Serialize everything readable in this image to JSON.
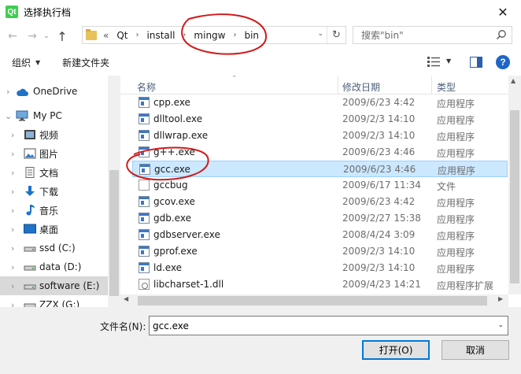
{
  "window": {
    "app_icon_letter": "Qt",
    "title": "选择执行档",
    "close_glyph": "✕"
  },
  "navigation": {
    "back_glyph": "←",
    "forward_glyph": "→",
    "recent_glyph": "⌄",
    "up_glyph": "↑"
  },
  "address": {
    "overflow": "«",
    "crumbs": [
      "Qt",
      "install",
      "mingw",
      "bin"
    ],
    "separator": "›",
    "dropdown_glyph": "⌄",
    "refresh_glyph": "↻"
  },
  "search": {
    "placeholder": "搜索\"bin\""
  },
  "toolbar": {
    "organize_label": "组织",
    "organize_caret": "▼",
    "new_folder_label": "新建文件夹",
    "view_caret": "▼",
    "help_glyph": "?"
  },
  "nav_pane": {
    "items": [
      {
        "label": "OneDrive",
        "icon": "cloud-icon",
        "chevron": "›"
      },
      {
        "label": "My PC",
        "icon": "computer-icon",
        "chevron": "⌄"
      },
      {
        "label": "视频",
        "icon": "video-folder-icon",
        "chevron": "›"
      },
      {
        "label": "图片",
        "icon": "pictures-folder-icon",
        "chevron": "›"
      },
      {
        "label": "文档",
        "icon": "documents-folder-icon",
        "chevron": "›"
      },
      {
        "label": "下载",
        "icon": "download-arrow-icon",
        "chevron": "›"
      },
      {
        "label": "音乐",
        "icon": "music-note-icon",
        "chevron": "›"
      },
      {
        "label": "桌面",
        "icon": "desktop-icon",
        "chevron": "›"
      },
      {
        "label": "ssd (C:)",
        "icon": "drive-icon",
        "chevron": "›"
      },
      {
        "label": "data (D:)",
        "icon": "drive-icon",
        "chevron": "›"
      },
      {
        "label": "software (E:)",
        "icon": "drive-icon",
        "chevron": "›",
        "selected": true
      },
      {
        "label": "ZZX (G:)",
        "icon": "drive-icon",
        "chevron": "›"
      }
    ]
  },
  "file_list": {
    "sort_glyph": "⌃",
    "columns": [
      "名称",
      "修改日期",
      "类型"
    ],
    "rows": [
      {
        "name": "cpp.exe",
        "date": "2009/6/23 4:42",
        "type": "应用程序",
        "icon": "exe"
      },
      {
        "name": "dlltool.exe",
        "date": "2009/2/3 14:10",
        "type": "应用程序",
        "icon": "exe"
      },
      {
        "name": "dllwrap.exe",
        "date": "2009/2/3 14:10",
        "type": "应用程序",
        "icon": "exe"
      },
      {
        "name": "g++.exe",
        "date": "2009/6/23 4:46",
        "type": "应用程序",
        "icon": "exe"
      },
      {
        "name": "gcc.exe",
        "date": "2009/6/23 4:46",
        "type": "应用程序",
        "icon": "exe",
        "selected": true
      },
      {
        "name": "gccbug",
        "date": "2009/6/17 11:34",
        "type": "文件",
        "icon": "file"
      },
      {
        "name": "gcov.exe",
        "date": "2009/6/23 4:42",
        "type": "应用程序",
        "icon": "exe"
      },
      {
        "name": "gdb.exe",
        "date": "2009/2/27 15:38",
        "type": "应用程序",
        "icon": "exe"
      },
      {
        "name": "gdbserver.exe",
        "date": "2008/4/24 3:09",
        "type": "应用程序",
        "icon": "exe"
      },
      {
        "name": "gprof.exe",
        "date": "2009/2/3 14:10",
        "type": "应用程序",
        "icon": "exe"
      },
      {
        "name": "ld.exe",
        "date": "2009/2/3 14:10",
        "type": "应用程序",
        "icon": "exe"
      },
      {
        "name": "libcharset-1.dll",
        "date": "2009/4/23 14:21",
        "type": "应用程序扩展",
        "icon": "dll"
      }
    ]
  },
  "scrollbars": {
    "up_glyph": "▲",
    "left_glyph": "◀",
    "right_glyph": "▶"
  },
  "footer": {
    "filename_label": "文件名(N):",
    "filename_value": "gcc.exe",
    "dropdown_glyph": "⌄",
    "open_label": "打开(O)",
    "cancel_label": "取消"
  },
  "colors": {
    "selection_bg": "#cce8ff",
    "selection_border": "#99d1ff",
    "accent": "#0078d7",
    "annotation_ink": "#d11a1a"
  }
}
